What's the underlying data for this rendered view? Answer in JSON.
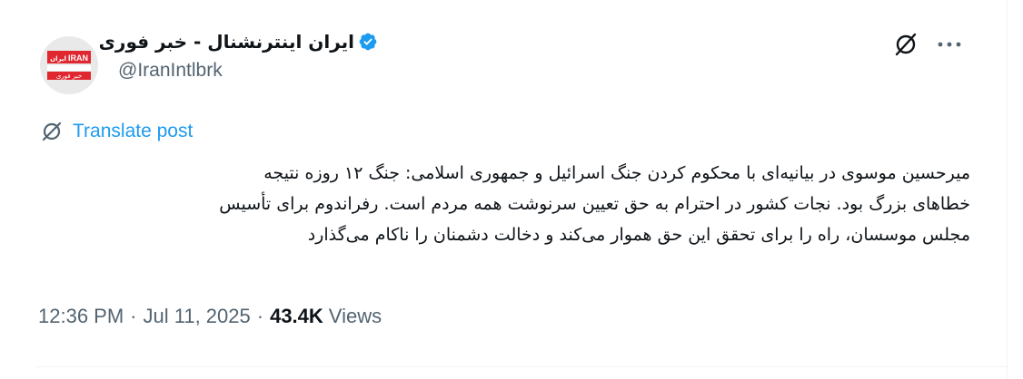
{
  "author": {
    "display_name": "ایران اینترنشنال - خبر فوری",
    "handle": "@IranIntlbrk",
    "avatar_logo_top": "IRAN",
    "avatar_logo_persian": "ایران",
    "avatar_logo_bottom": "خبر فوری",
    "verified": true
  },
  "actions": {
    "grok_icon": "grok-icon",
    "more_icon": "more-icon"
  },
  "translate": {
    "label": "Translate post",
    "icon": "translate-icon"
  },
  "post": {
    "lines": [
      "میرحسین موسوی در بیانیه‌ای با محکوم کردن جنگ اسرائیل و جمهوری اسلامی: جنگ ۱۲ روزه نتیجه",
      "خطاهای بزرگ بود. نجات کشور در احترام به حق تعیین سرنوشت همه مردم است. رفراندوم برای تأسیس",
      "مجلس موسسان، راه را برای تحقق این حق هموار می‌کند و دخالت دشمنان را ناکام می‌گذارد"
    ]
  },
  "meta": {
    "time": "12:36 PM",
    "separator": "·",
    "date": "Jul 11, 2025",
    "views_count": "43.4K",
    "views_label": "Views"
  },
  "colors": {
    "accent": "#1d9bf0",
    "secondary_text": "#536471",
    "primary_text": "#0f1419",
    "brand_red": "#e0262e"
  }
}
